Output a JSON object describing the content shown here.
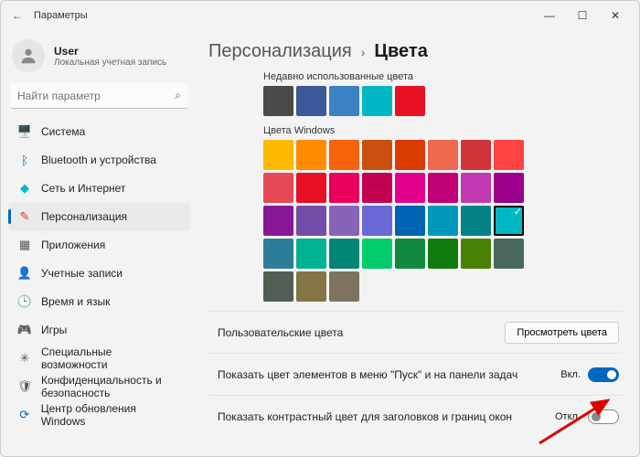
{
  "window": {
    "title": "Параметры"
  },
  "user": {
    "name": "User",
    "subtitle": "Локальная учетная запись"
  },
  "search": {
    "placeholder": "Найти параметр"
  },
  "sidebar": {
    "items": [
      {
        "label": "Система",
        "icon": "🖥️",
        "color": "#0067c0"
      },
      {
        "label": "Bluetooth и устройства",
        "icon": "ᛒ",
        "color": "#0067c0"
      },
      {
        "label": "Сеть и Интернет",
        "icon": "◆",
        "color": "#00b7c3"
      },
      {
        "label": "Персонализация",
        "icon": "✎",
        "color": "#d13438",
        "active": true
      },
      {
        "label": "Приложения",
        "icon": "▦",
        "color": "#555"
      },
      {
        "label": "Учетные записи",
        "icon": "👤",
        "color": "#555"
      },
      {
        "label": "Время и язык",
        "icon": "🕒",
        "color": "#555"
      },
      {
        "label": "Игры",
        "icon": "🎮",
        "color": "#555"
      },
      {
        "label": "Специальные возможности",
        "icon": "✳",
        "color": "#555"
      },
      {
        "label": "Конфиденциальность и безопасность",
        "icon": "🛡",
        "color": "#555"
      },
      {
        "label": "Центр обновления Windows",
        "icon": "⟳",
        "color": "#0067c0"
      }
    ]
  },
  "breadcrumb": {
    "parent": "Персонализация",
    "current": "Цвета"
  },
  "recent": {
    "label": "Недавно использованные цвета",
    "colors": [
      "#4c4a48",
      "#3b5998",
      "#3a82c4",
      "#00b7c3",
      "#e81123"
    ]
  },
  "windows_colors": {
    "label": "Цвета Windows",
    "colors": [
      "#ffb900",
      "#ff8c00",
      "#f7630c",
      "#ca5010",
      "#da3b01",
      "#ef6950",
      "#d13438",
      "#ff4343",
      "#e74856",
      "#e81123",
      "#ea005e",
      "#c30052",
      "#e3008c",
      "#bf0077",
      "#c239b3",
      "#9a0089",
      "#881798",
      "#744da9",
      "#8764b8",
      "#6b69d6",
      "#0063b1",
      "#0099bc",
      "#038387",
      "#00b7c3",
      "#2d7d9a",
      "#00b294",
      "#018574",
      "#00cc6a",
      "#10893e",
      "#107c10",
      "#498205",
      "#486860",
      "#525e54",
      "#847545",
      "#7e735f"
    ],
    "selected_index": 23
  },
  "custom_colors": {
    "label": "Пользовательские цвета",
    "button": "Просмотреть цвета"
  },
  "setting_start": {
    "label": "Показать цвет элементов в меню \"Пуск\" и на панели задач",
    "state_label": "Вкл.",
    "on": true
  },
  "setting_title": {
    "label": "Показать контрастный цвет для заголовков и границ окон",
    "state_label": "Откл.",
    "on": false
  }
}
